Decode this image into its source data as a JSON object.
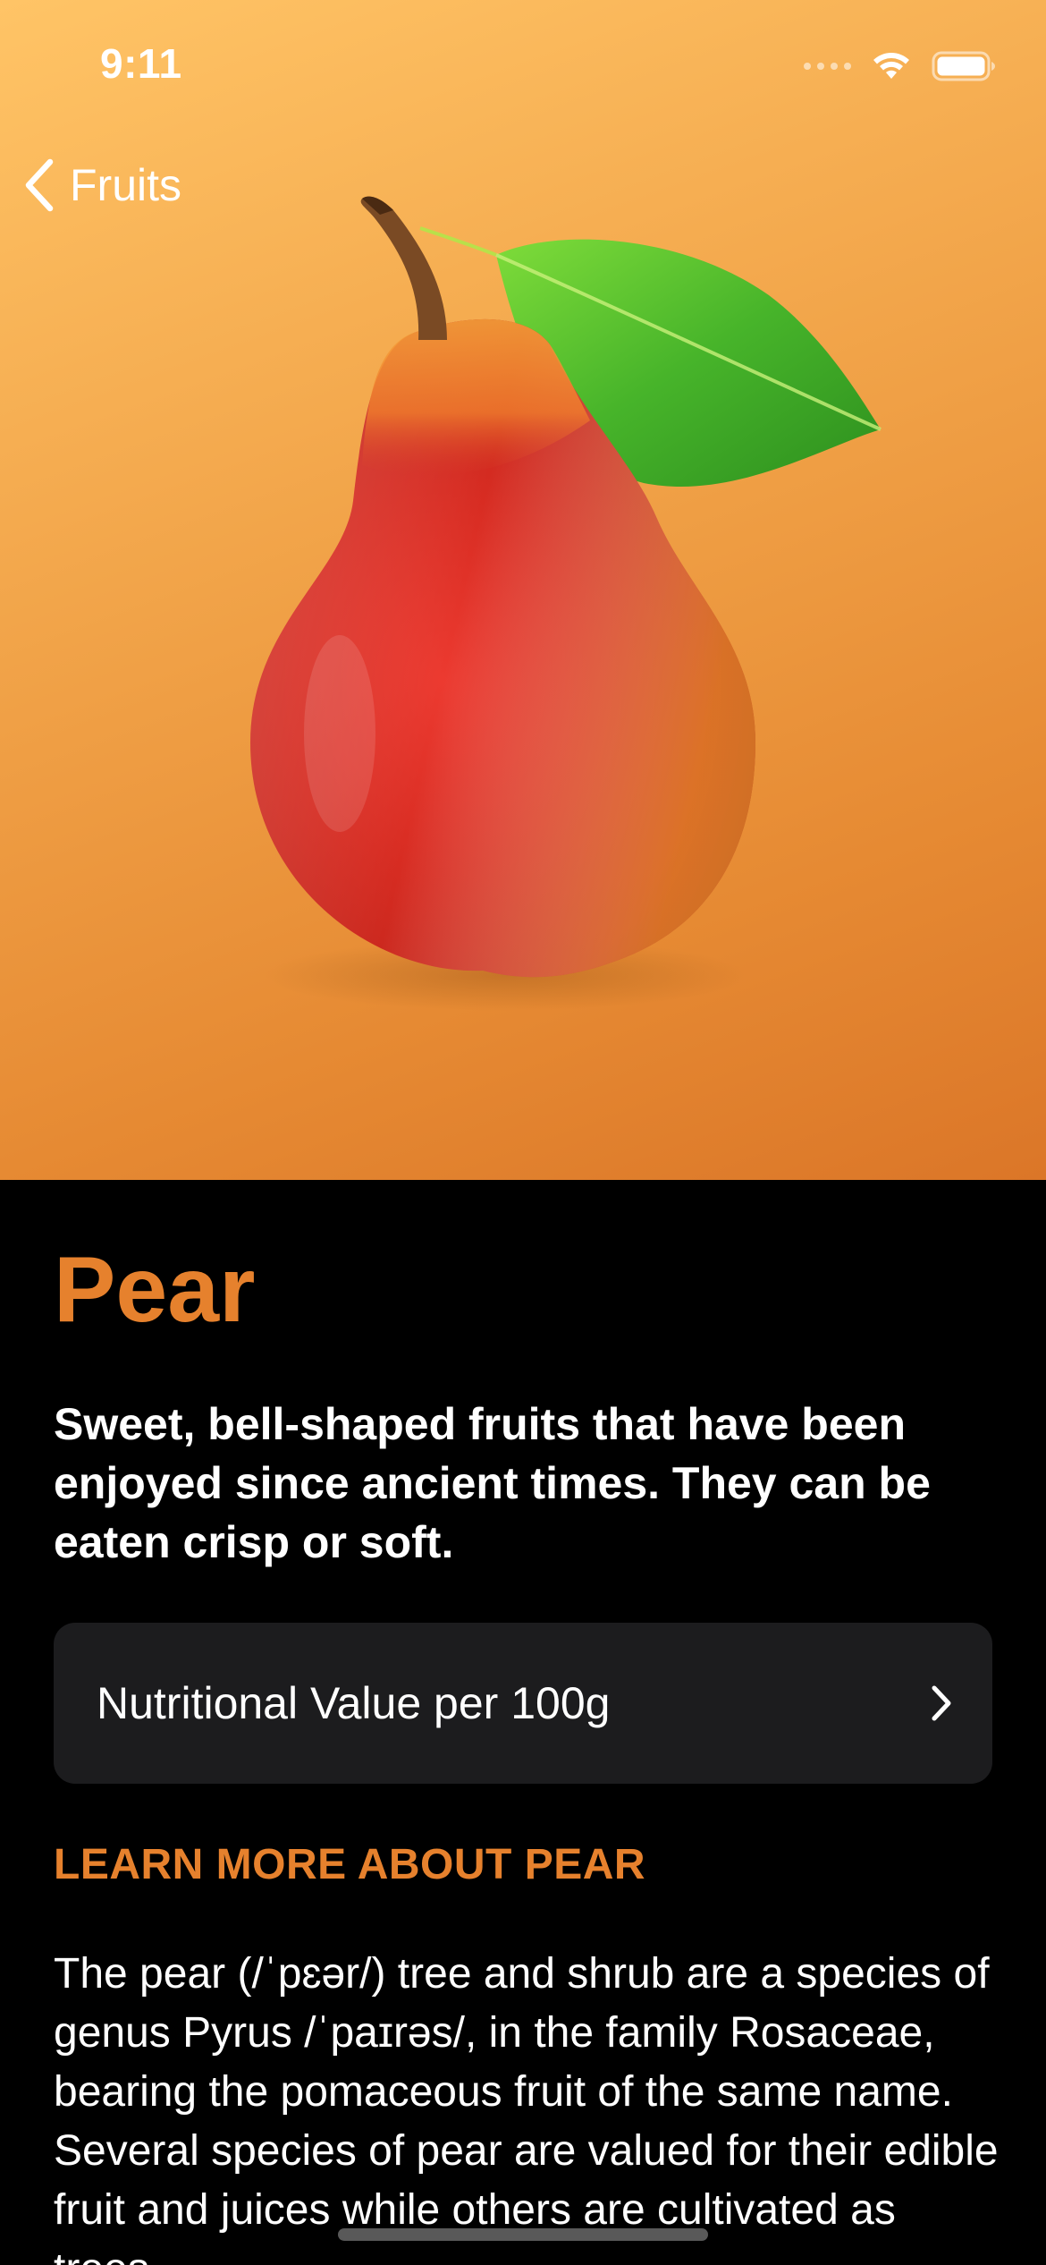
{
  "status_bar": {
    "time": "9:11",
    "icons": [
      "cellular-dots-icon",
      "wifi-icon",
      "battery-icon"
    ]
  },
  "navigation": {
    "back_label": "Fruits",
    "back_icon": "chevron-left-icon"
  },
  "hero": {
    "image": "pear-illustration",
    "colors": {
      "gradient_start": "#ffc466",
      "gradient_end": "#db7628"
    }
  },
  "fruit": {
    "title": "Pear",
    "summary": "Sweet, bell-shaped fruits that have been enjoyed since ancient times. They can be eaten crisp or soft.",
    "nutrition_label": "Nutritional Value per 100g",
    "nutrition_icon": "chevron-right-icon",
    "learn_more_header": "LEARN MORE ABOUT PEAR",
    "description": "The pear (/ˈpɛər/) tree and shrub are a species of genus Pyrus /ˈpaɪrəs/, in the family Rosaceae, bearing the pomaceous fruit of the same name. Several species of pear are valued for their edible fruit and juices while others are cultivated as trees."
  },
  "theme": {
    "accent": "#e6812d",
    "background": "#000000",
    "card": "#1c1c1e",
    "text": "#ffffff"
  }
}
